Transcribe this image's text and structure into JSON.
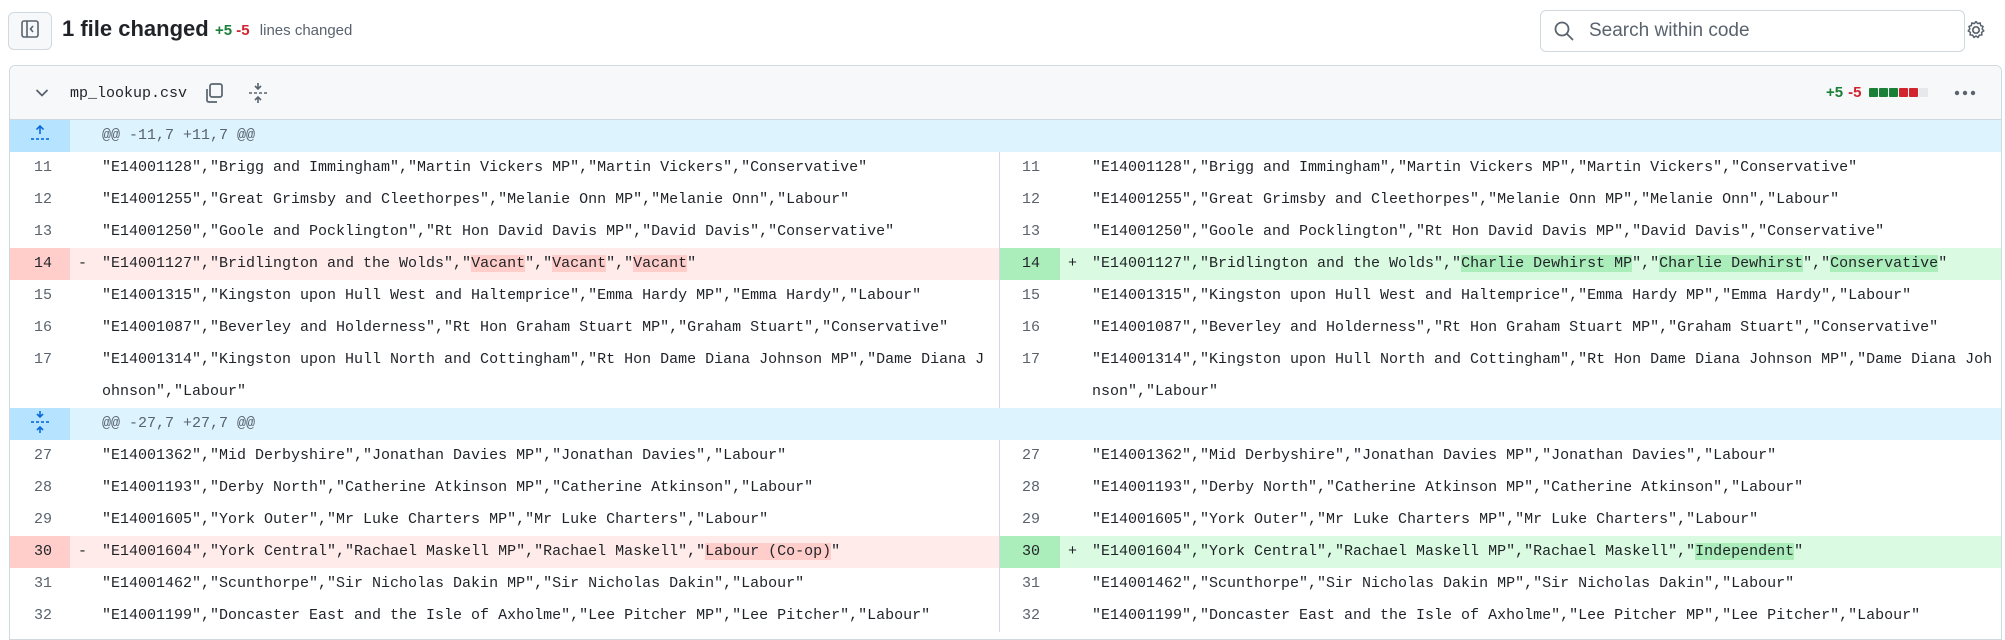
{
  "toolbar": {
    "files_changed": "1 file changed",
    "additions": "+5",
    "deletions": "-5",
    "lines_changed_label": "lines changed",
    "search_placeholder": "Search within code",
    "toggle_icon": "sidebar-toggle-icon",
    "search_icon": "search-icon",
    "settings_icon": "gear-icon"
  },
  "file": {
    "name": "mp_lookup.csv",
    "additions": "+5",
    "deletions": "-5",
    "diffstat_squares": [
      "add",
      "add",
      "add",
      "del",
      "del",
      "neutral"
    ],
    "icons": [
      "chevron-down-icon",
      "copy-icon",
      "expand-all-icon",
      "kebab-icon"
    ]
  },
  "colors": {
    "add": "#1a7f37",
    "del": "#d1242f",
    "hunk_bg": "#ddf4ff",
    "removed_bg": "#ffebe9",
    "added_bg": "#dafbe1"
  },
  "hunks": [
    {
      "header": "@@ -11,7 +11,7 @@",
      "lines": [
        {
          "l": "11",
          "r": "11",
          "type": "context",
          "text": "\"E14001128\",\"Brigg and Immingham\",\"Martin Vickers MP\",\"Martin Vickers\",\"Conservative\""
        },
        {
          "l": "12",
          "r": "12",
          "type": "context",
          "text": "\"E14001255\",\"Great Grimsby and Cleethorpes\",\"Melanie Onn MP\",\"Melanie Onn\",\"Labour\""
        },
        {
          "l": "13",
          "r": "13",
          "type": "context",
          "text": "\"E14001250\",\"Goole and Pocklington\",\"Rt Hon David Davis MP\",\"David Davis\",\"Conservative\""
        },
        {
          "l": "14",
          "r": "14",
          "type": "change",
          "marker_left": "-",
          "marker_right": "+",
          "left_prefix": "\"E14001127\",\"Bridlington and the Wolds\",\"",
          "left_parts": [
            "Vacant",
            "\",\"",
            "Vacant",
            "\",\"",
            "Vacant"
          ],
          "left_suffix": "\"",
          "right_prefix": "\"E14001127\",\"Bridlington and the Wolds\",\"",
          "right_parts": [
            "Charlie Dewhirst MP",
            "\",\"",
            "Charlie Dewhirst",
            "\",\"",
            "Conservative"
          ],
          "right_suffix": "\""
        },
        {
          "l": "15",
          "r": "15",
          "type": "context",
          "text": "\"E14001315\",\"Kingston upon Hull West and Haltemprice\",\"Emma Hardy MP\",\"Emma Hardy\",\"Labour\""
        },
        {
          "l": "16",
          "r": "16",
          "type": "context",
          "text": "\"E14001087\",\"Beverley and Holderness\",\"Rt Hon Graham Stuart MP\",\"Graham Stuart\",\"Conservative\""
        },
        {
          "l": "17",
          "r": "17",
          "type": "context",
          "text": "\"E14001314\",\"Kingston upon Hull North and Cottingham\",\"Rt Hon Dame Diana Johnson MP\",\"Dame Diana Johnson\",\"Labour\""
        }
      ]
    },
    {
      "header": "@@ -27,7 +27,7 @@",
      "lines": [
        {
          "l": "27",
          "r": "27",
          "type": "context",
          "text": "\"E14001362\",\"Mid Derbyshire\",\"Jonathan Davies MP\",\"Jonathan Davies\",\"Labour\""
        },
        {
          "l": "28",
          "r": "28",
          "type": "context",
          "text": "\"E14001193\",\"Derby North\",\"Catherine Atkinson MP\",\"Catherine Atkinson\",\"Labour\""
        },
        {
          "l": "29",
          "r": "29",
          "type": "context",
          "text": "\"E14001605\",\"York Outer\",\"Mr Luke Charters MP\",\"Mr Luke Charters\",\"Labour\""
        },
        {
          "l": "30",
          "r": "30",
          "type": "change",
          "marker_left": "-",
          "marker_right": "+",
          "left_prefix": "\"E14001604\",\"York Central\",\"Rachael Maskell MP\",\"Rachael Maskell\",\"",
          "left_parts": [
            "Labour (Co-op)"
          ],
          "left_suffix": "\"",
          "right_prefix": "\"E14001604\",\"York Central\",\"Rachael Maskell MP\",\"Rachael Maskell\",\"",
          "right_parts": [
            "Independent"
          ],
          "right_suffix": "\""
        },
        {
          "l": "31",
          "r": "31",
          "type": "context",
          "text": "\"E14001462\",\"Scunthorpe\",\"Sir Nicholas Dakin MP\",\"Sir Nicholas Dakin\",\"Labour\""
        },
        {
          "l": "32",
          "r": "32",
          "type": "context",
          "text": "\"E14001199\",\"Doncaster East and the Isle of Axholme\",\"Lee Pitcher MP\",\"Lee Pitcher\",\"Labour\""
        }
      ]
    }
  ]
}
